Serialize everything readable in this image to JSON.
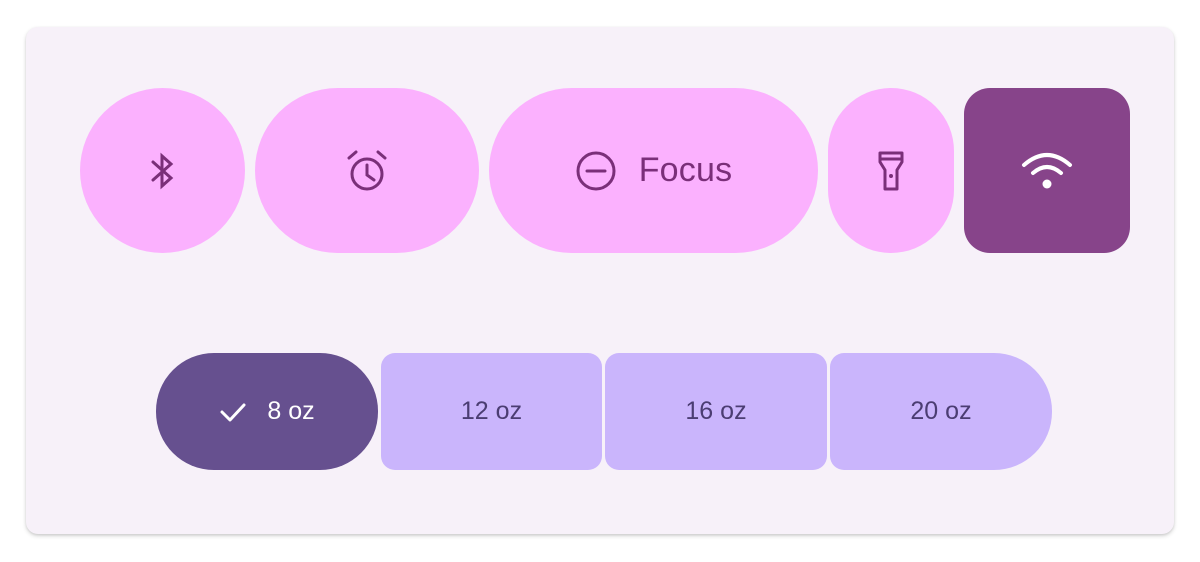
{
  "colors": {
    "card_background": "#f7f1f9",
    "tile_pink": "#fbb1fe",
    "tile_icon": "#7a2f79",
    "tile_selected": "#87448a",
    "segment_unselected": "#cab5fc",
    "segment_selected": "#66508f"
  },
  "toggle_row": {
    "items": [
      {
        "icon": "bluetooth-icon",
        "selected": false
      },
      {
        "icon": "alarm-icon",
        "selected": false
      },
      {
        "icon": "do-not-disturb-icon",
        "label": "Focus",
        "selected": false
      },
      {
        "icon": "flashlight-icon",
        "selected": false
      },
      {
        "icon": "wifi-icon",
        "selected": true
      }
    ]
  },
  "size_selector": {
    "options": [
      {
        "label": "8 oz",
        "selected": true,
        "icon": "check-icon"
      },
      {
        "label": "12 oz",
        "selected": false
      },
      {
        "label": "16 oz",
        "selected": false
      },
      {
        "label": "20 oz",
        "selected": false
      }
    ]
  }
}
